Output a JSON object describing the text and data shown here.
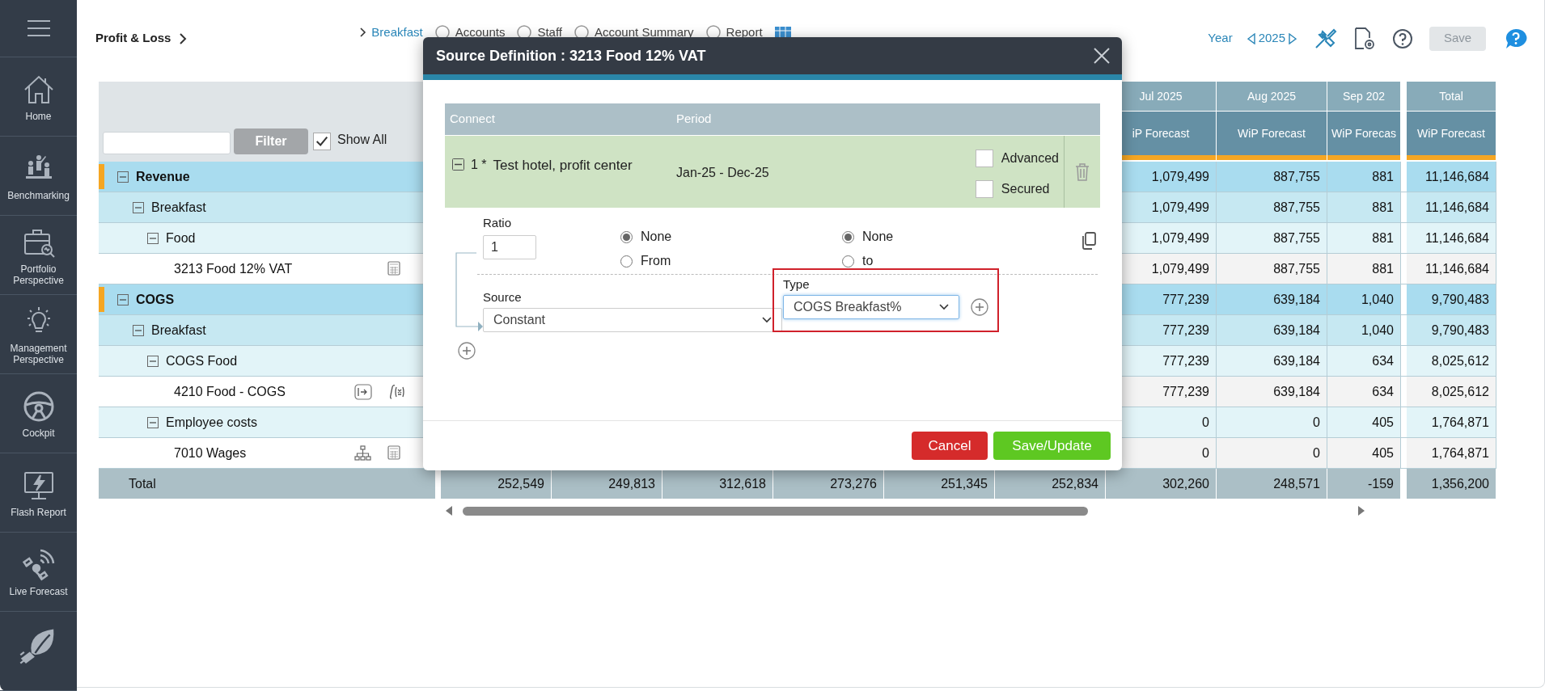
{
  "sidebar": {
    "items": [
      {
        "label": "Home"
      },
      {
        "label": "Benchmarking"
      },
      {
        "label": "Portfolio Perspective"
      },
      {
        "label": "Management Perspective"
      },
      {
        "label": "Cockpit"
      },
      {
        "label": "Flash Report"
      },
      {
        "label": "Live Forecast"
      },
      {
        "kind": "icon_only"
      }
    ]
  },
  "header": {
    "title": "Profit & Loss",
    "breadcrumb": [
      "Breakfast",
      "Accounts",
      "Staff",
      "Account Summary",
      "Report"
    ],
    "year_label": "Year",
    "year": "2025",
    "save": {
      "label": "Save",
      "disabled": true
    }
  },
  "table": {
    "filter": {
      "button": "Filter",
      "show_all": {
        "label": "Show All",
        "checked": true
      }
    },
    "columns": [
      {
        "month": "Jul 2025",
        "subheader": "iP Forecast"
      },
      {
        "month": "Aug 2025",
        "subheader": "WiP Forecast"
      },
      {
        "month": "Sep 202",
        "subheader": "WiP Forecas"
      },
      {
        "month": "Total",
        "subheader": "WiP Forecast"
      }
    ],
    "rows": [
      {
        "label": "Revenue",
        "expanded": true,
        "values": [
          "1,079,499",
          "887,755",
          "881",
          "11,146,684"
        ],
        "children": [
          {
            "label": "Breakfast",
            "expanded": true,
            "values": [
              "1,079,499",
              "887,755",
              "881",
              "11,146,684"
            ],
            "children": [
              {
                "label": "Food",
                "expanded": true,
                "values": [
                  "1,079,499",
                  "887,755",
                  "881",
                  "11,146,684"
                ],
                "children": [
                  {
                    "label": "3213 Food 12% VAT",
                    "tools": [
                      {
                        "kind": "calculator"
                      }
                    ],
                    "values": [
                      "1,079,499",
                      "887,755",
                      "881",
                      "11,146,684"
                    ]
                  }
                ]
              }
            ]
          }
        ]
      },
      {
        "label": "COGS",
        "expanded": true,
        "values": [
          "777,239",
          "639,184",
          "1,040",
          "9,790,483"
        ],
        "children": [
          {
            "label": "Breakfast",
            "expanded": true,
            "values": [
              "777,239",
              "639,184",
              "1,040",
              "9,790,483"
            ],
            "children": [
              {
                "label": "COGS Food",
                "expanded": true,
                "values": [
                  "777,239",
                  "639,184",
                  "634",
                  "8,025,612"
                ],
                "children": [
                  {
                    "label": "4210 Food - COGS",
                    "tools": [
                      {
                        "kind": "link"
                      },
                      {
                        "kind": "formula"
                      }
                    ],
                    "values": [
                      "777,239",
                      "639,184",
                      "634",
                      "8,025,612"
                    ]
                  }
                ]
              },
              {
                "label": "Employee costs",
                "expanded": true,
                "values": [
                  "0",
                  "0",
                  "405",
                  "1,764,871"
                ],
                "children": [
                  {
                    "label": "7010 Wages",
                    "tools": [
                      {
                        "kind": "hierarchy"
                      },
                      {
                        "kind": "calculator"
                      }
                    ],
                    "values": [
                      "0",
                      "0",
                      "405",
                      "1,764,871"
                    ]
                  }
                ]
              }
            ]
          }
        ]
      }
    ],
    "total_row": {
      "label": "Total",
      "values": [
        "252,549",
        "249,813",
        "312,618",
        "273,276",
        "251,345",
        "252,834",
        "302,260",
        "248,571",
        "-159",
        "1,356,200"
      ]
    }
  },
  "dialog": {
    "title": "Source Definition : 3213 Food 12% VAT",
    "columns": [
      "Connect",
      "Period"
    ],
    "connection": {
      "expanded": true,
      "index": "1 *",
      "name": "Test hotel, profit center",
      "period": "Jan-25 - Dec-25",
      "options": [
        {
          "label": "Advanced",
          "checked": false
        },
        {
          "label": "Secured",
          "checked": false
        }
      ]
    },
    "ratio": {
      "label": "Ratio",
      "value": "1"
    },
    "from_options": [
      {
        "label": "None",
        "selected": true
      },
      {
        "label": "From",
        "selected": false
      }
    ],
    "to_options": [
      {
        "label": "None",
        "selected": true
      },
      {
        "label": "to",
        "selected": false
      }
    ],
    "source": {
      "label": "Source",
      "value": "Constant"
    },
    "type": {
      "label": "Type",
      "value": "COGS Breakfast%",
      "highlighted": true
    },
    "buttons": [
      {
        "label": "Cancel",
        "kind": "danger"
      },
      {
        "label": "Save/Update",
        "kind": "primary"
      }
    ]
  }
}
